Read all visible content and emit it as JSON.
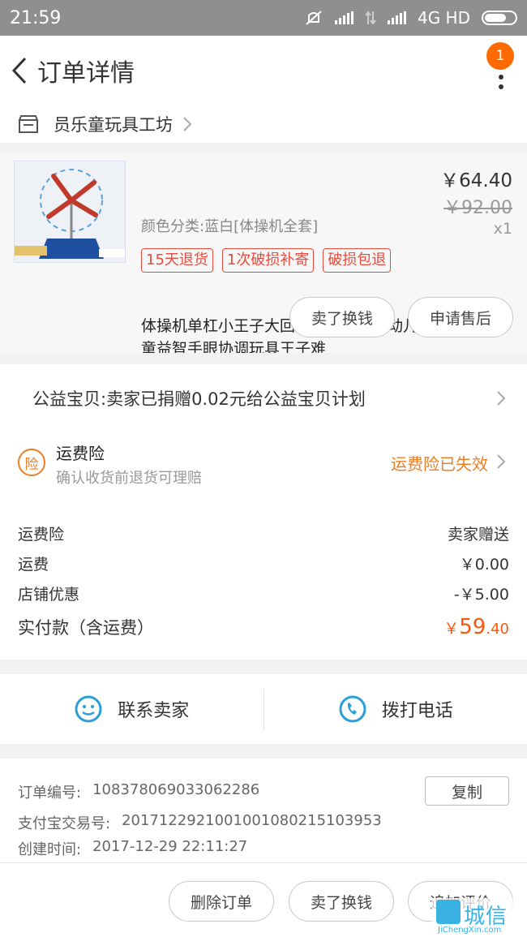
{
  "status_bar": {
    "time": "21:59",
    "network": "4G HD"
  },
  "header": {
    "title": "订单详情",
    "badge_count": "1"
  },
  "shop": {
    "name": "员乐童玩具工坊"
  },
  "item": {
    "title": "体操机单杠小王子大回环亲子桌游互动儿童益智手眼协调玩具王子难",
    "variant": "颜色分类:蓝白[体操机全套]",
    "price": "￥64.40",
    "original_price": "￥92.00",
    "quantity": "x1",
    "tags": [
      "15天退货",
      "1次破损补寄",
      "破损包退"
    ],
    "buttons": [
      "卖了换钱",
      "申请售后"
    ]
  },
  "charity": {
    "text": "公益宝贝:卖家已捐赠0.02元给公益宝贝计划"
  },
  "insurance": {
    "icon_text": "险",
    "title": "运费险",
    "subtitle": "确认收货前退货可理赔",
    "status": "运费险已失效"
  },
  "fees": [
    {
      "label": "运费险",
      "value": "卖家赠送"
    },
    {
      "label": "运费",
      "value": "￥0.00"
    },
    {
      "label": "店铺优惠",
      "value": "-￥5.00"
    }
  ],
  "total": {
    "label": "实付款（含运费）",
    "currency": "￥",
    "integer": "59",
    "decimal": ".40"
  },
  "contact": {
    "seller": "联系卖家",
    "phone": "拨打电话"
  },
  "order_info": {
    "order_no_label": "订单编号:",
    "order_no": "108378069033062286",
    "alipay_label": "支付宝交易号:",
    "alipay_no": "2017122921001001080215103953",
    "created_label": "创建时间:",
    "created": "2017-12-29 22:11:27",
    "copy": "复制"
  },
  "bottom_bar": {
    "delete": "删除订单",
    "sell": "卖了换钱",
    "review": "追加评价"
  },
  "watermark": {
    "chars": "城信",
    "en": "JiChengXin.com"
  },
  "colors": {
    "accent": "#f05a13",
    "insurance": "#f07d1f",
    "tag": "#e74c3c",
    "badge": "#ff6a00"
  }
}
